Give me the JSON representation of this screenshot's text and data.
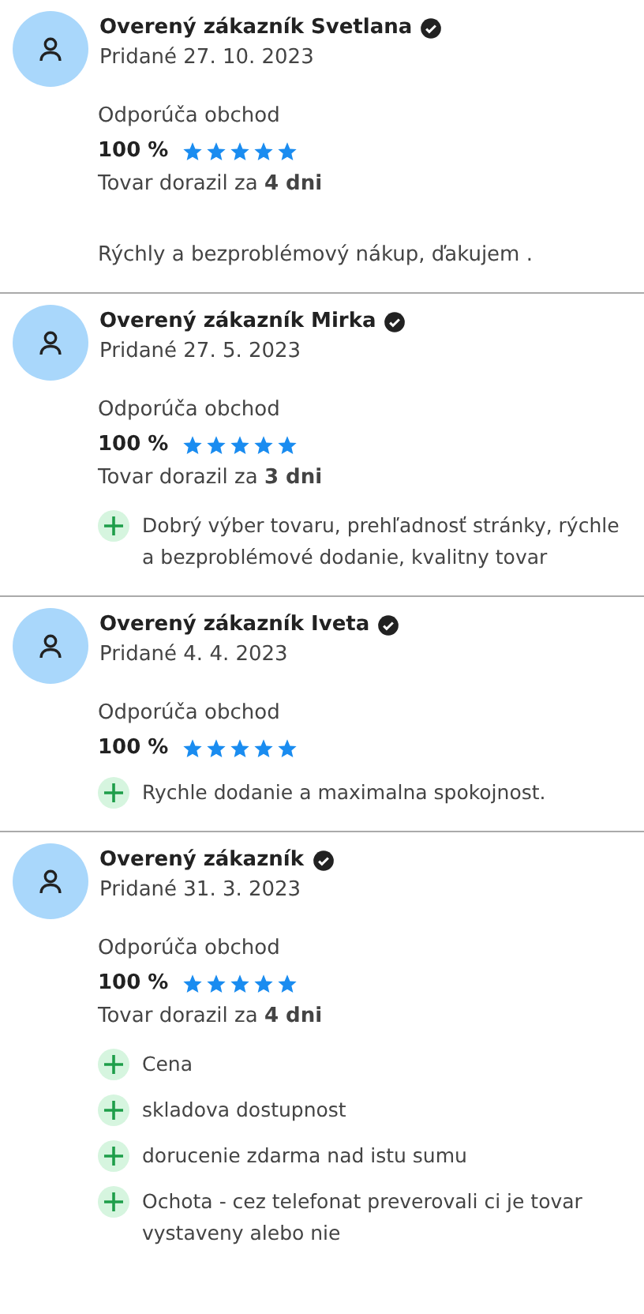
{
  "reviews": [
    {
      "name": "Overený zákazník Svetlana",
      "verified": true,
      "date": "Pridané 27. 10. 2023",
      "recommend_label": "Odporúča obchod",
      "percent": "100 %",
      "stars": 5,
      "delivery": "Tovar dorazil za **4 dni**",
      "comment": "Rýchly a bezproblémový nákup, ďakujem ."
    },
    {
      "name": "Overený zákazník Mirka",
      "verified": true,
      "date": "Pridané 27. 5. 2023",
      "recommend_label": "Odporúča obchod",
      "percent": "100 %",
      "stars": 5,
      "delivery": "Tovar dorazil za **3 dni**",
      "pros": [
        "Dobrý výber tovaru, prehľadnosť stránky, rýchle a bezproblémové dodanie, kvalitny tovar"
      ]
    },
    {
      "name": "Overený zákazník Iveta",
      "verified": true,
      "date": "Pridané 4. 4. 2023",
      "recommend_label": "Odporúča obchod",
      "percent": "100 %",
      "stars": 5,
      "pros": [
        "Rychle dodanie a maximalna spokojnost."
      ]
    },
    {
      "name": "Overený zákazník",
      "verified": true,
      "date": "Pridané 31. 3. 2023",
      "recommend_label": "Odporúča obchod",
      "percent": "100 %",
      "stars": 5,
      "delivery": "Tovar dorazil za **4 dni**",
      "pros": [
        "Cena",
        "skladova dostupnost",
        "dorucenie zdarma nad istu sumu",
        "Ochota - cez telefonat preverovali ci je tovar vystaveny alebo nie"
      ]
    }
  ]
}
